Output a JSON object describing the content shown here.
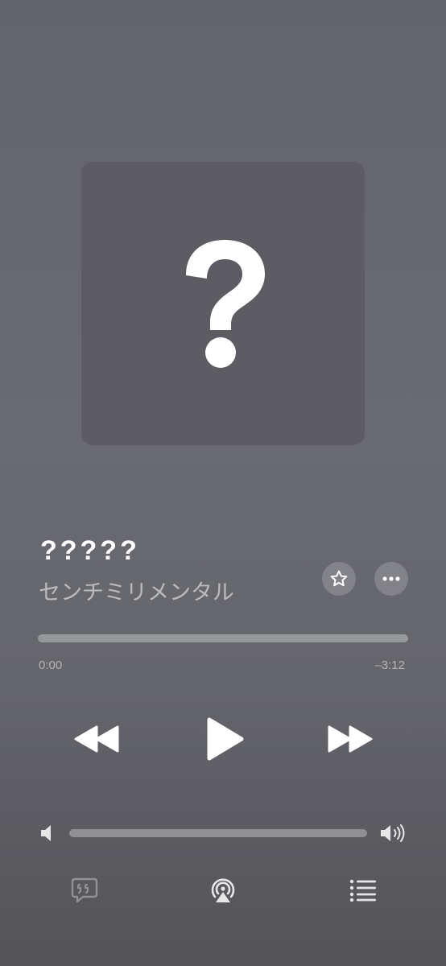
{
  "artwork": {
    "placeholder_icon": "question-mark-icon"
  },
  "track": {
    "title": "?????",
    "artist": "センチミリメンタル"
  },
  "actions": {
    "favorite_icon": "star-icon",
    "more_icon": "ellipsis-icon"
  },
  "progress": {
    "elapsed": "0:00",
    "remaining": "–3:12",
    "fraction": 0
  },
  "transport": {
    "rewind_icon": "rewind-icon",
    "play_icon": "play-icon",
    "forward_icon": "fast-forward-icon"
  },
  "volume": {
    "low_icon": "speaker-low-icon",
    "high_icon": "speaker-high-icon",
    "level": 0
  },
  "bottom_bar": {
    "lyrics_icon": "lyrics-icon",
    "airplay_icon": "airplay-icon",
    "queue_icon": "queue-list-icon"
  },
  "colors": {
    "background_top": "#63646b",
    "background_bottom": "#535358",
    "artwork_bg": "#5c5c62",
    "foreground": "#ffffff"
  }
}
